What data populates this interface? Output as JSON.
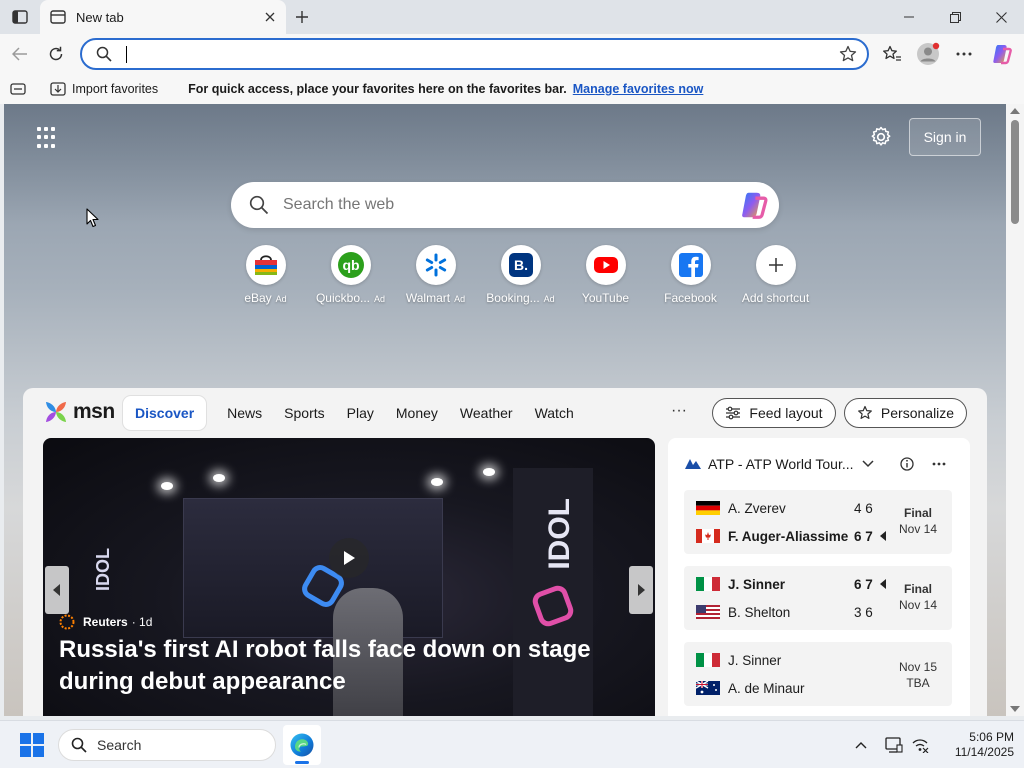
{
  "browser": {
    "tab_title": "New tab",
    "address_value": "",
    "address_placeholder": ""
  },
  "favorites_bar": {
    "import_label": "Import favorites",
    "hint": "For quick access, place your favorites here on the favorites bar.",
    "manage_link": "Manage favorites now"
  },
  "ntp": {
    "signin_label": "Sign in",
    "search_placeholder": "Search the web",
    "shortcuts": [
      {
        "label": "eBay",
        "ad": "Ad",
        "icon": "ebay-bag-icon"
      },
      {
        "label": "Quickbo...",
        "ad": "Ad",
        "icon": "quickbooks-icon"
      },
      {
        "label": "Walmart",
        "ad": "Ad",
        "icon": "walmart-icon"
      },
      {
        "label": "Booking...",
        "ad": "Ad",
        "icon": "booking-icon"
      },
      {
        "label": "YouTube",
        "ad": "",
        "icon": "youtube-icon"
      },
      {
        "label": "Facebook",
        "ad": "",
        "icon": "facebook-icon"
      },
      {
        "label": "Add shortcut",
        "ad": "",
        "icon": "plus-icon"
      }
    ]
  },
  "feed": {
    "logo_text": "msn",
    "tabs": [
      "Discover",
      "News",
      "Sports",
      "Play",
      "Money",
      "Weather",
      "Watch"
    ],
    "more": "···",
    "feed_layout_label": "Feed layout",
    "personalize_label": "Personalize",
    "hero": {
      "brand": "IDOL",
      "source": "Reuters",
      "time": "· 1d",
      "title": "Russia's first AI robot falls face down on stage during debut appearance"
    }
  },
  "scores": {
    "league": "ATP - ATP World Tour...",
    "matches": [
      {
        "players": [
          {
            "name": "A. Zverev",
            "score": "4 6",
            "winner": false,
            "flag": "germany"
          },
          {
            "name": "F. Auger-Aliassime",
            "score": "6 7",
            "winner": true,
            "flag": "canada"
          }
        ],
        "status": "Final",
        "date": "Nov 14"
      },
      {
        "players": [
          {
            "name": "J. Sinner",
            "score": "6 7",
            "winner": true,
            "flag": "italy"
          },
          {
            "name": "B. Shelton",
            "score": "3 6",
            "winner": false,
            "flag": "usa"
          }
        ],
        "status": "Final",
        "date": "Nov 14"
      },
      {
        "players": [
          {
            "name": "J. Sinner",
            "score": "",
            "winner": false,
            "flag": "italy"
          },
          {
            "name": "A. de Minaur",
            "score": "",
            "winner": false,
            "flag": "australia"
          }
        ],
        "status": "TBA",
        "date": "Nov 15"
      }
    ]
  },
  "taskbar": {
    "search_label": "Search",
    "time": "5:06 PM",
    "date": "11/14/2025"
  },
  "colors": {
    "accent": "#2b6ccf",
    "link": "#1a56c4",
    "start": "#1a73e8"
  }
}
